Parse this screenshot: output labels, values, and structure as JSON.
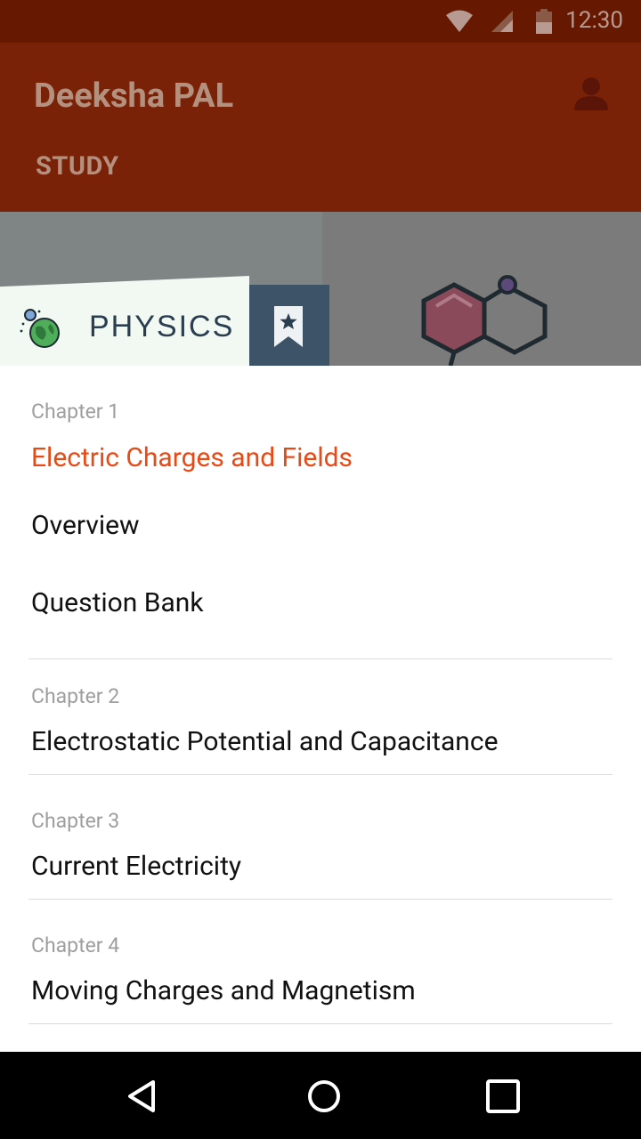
{
  "status_bar": {
    "time": "12:30",
    "icons": [
      "wifi-icon",
      "signal-icon",
      "battery-icon"
    ]
  },
  "app_bar": {
    "title": "Deeksha PAL",
    "section": "STUDY",
    "account_icon": "account-icon"
  },
  "banner": {
    "subject": "PHYSICS",
    "subject_icon": "globe-icon",
    "bookmark_icon": "bookmark-star-icon"
  },
  "chapters": [
    {
      "number": "Chapter 1",
      "title": "Electric Charges and Fields",
      "items": [
        "Overview",
        "Question Bank"
      ]
    },
    {
      "number": "Chapter 2",
      "title": "Electrostatic Potential and Capacitance"
    },
    {
      "number": "Chapter 3",
      "title": "Current Electricity"
    },
    {
      "number": "Chapter 4",
      "title": "Moving Charges and Magnetism"
    }
  ],
  "colors": {
    "status_bar": "#671800",
    "app_bar": "#7a2207",
    "active_chapter": "#e84a16",
    "subject_text": "#2a3e50",
    "bookmark_bg": "#3d5468"
  },
  "nav_bar": {
    "icons": [
      "back-icon",
      "home-icon",
      "recents-icon"
    ]
  }
}
